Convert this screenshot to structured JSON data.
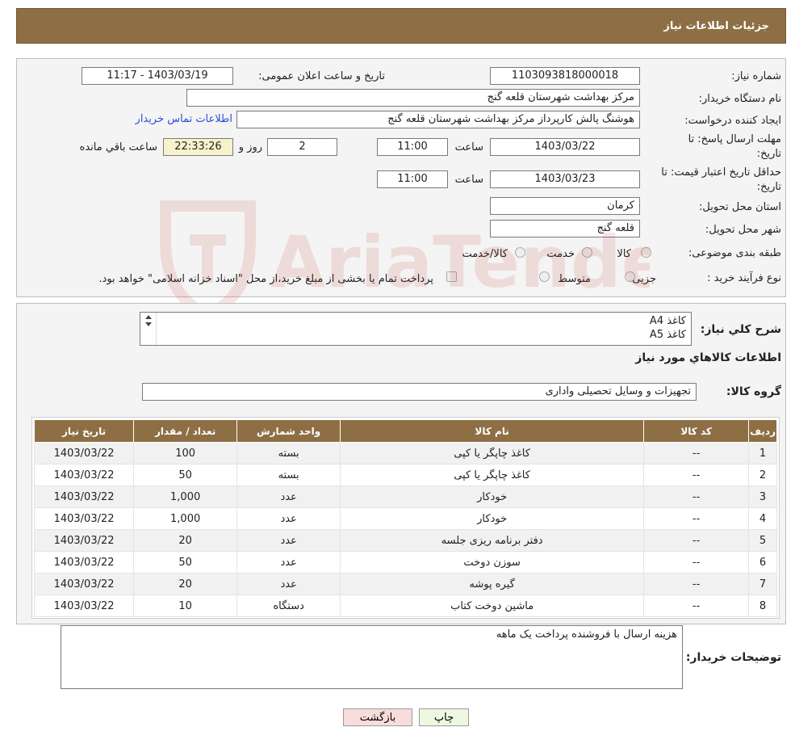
{
  "header": {
    "title": "جزئیات اطلاعات نیاز"
  },
  "fields": {
    "need_number_label": "شماره نیاز:",
    "need_number": "1103093818000018",
    "announce_label": "تاریخ و ساعت اعلان عمومی:",
    "announce_value": "1403/03/19 - 11:17",
    "buyer_org_label": "نام دستگاه خریدار:",
    "buyer_org": "مرکز بهداشت شهرستان قلعه گنج",
    "creator_label": "ایجاد کننده درخواست:",
    "creator": "هوشنگ پالش کارپرداز مرکز بهداشت شهرستان قلعه گنج",
    "contact_link": "اطلاعات تماس خریدار",
    "deadline_label_1": "مهلت ارسال پاسخ: تا",
    "deadline_label_2": "تاریخ:",
    "deadline_date": "1403/03/22",
    "time_label": "ساعت",
    "deadline_time": "11:00",
    "days_value": "2",
    "days_label": "روز و",
    "remaining_value": "22:33:26",
    "remaining_label": "ساعت باقي مانده",
    "validity_label_1": "حداقل تاریخ اعتبار قیمت: تا",
    "validity_label_2": "تاریخ:",
    "validity_date": "1403/03/23",
    "validity_time": "11:00",
    "province_label": "استان محل تحویل:",
    "province": "کرمان",
    "city_label": "شهر محل تحویل:",
    "city": "قلعه گنج",
    "category_label": "طبقه بندی موضوعی:",
    "category_options": [
      "کالا",
      "خدمت",
      "کالا/خدمت"
    ],
    "process_label": "نوع فرآیند خرید :",
    "process_options": [
      "جزیی",
      "متوسط"
    ],
    "process_note": "پرداخت تمام یا بخشی از مبلغ خرید،از محل \"اسناد خزانه اسلامی\" خواهد بود."
  },
  "description": {
    "label": "شرح کلي نیاز:",
    "lines": [
      "کاغذ A4",
      "کاغذ A5"
    ]
  },
  "goods": {
    "section_title": "اطلاعات کالاهاي مورد نیاز",
    "group_label": "گروه کالا:",
    "group_value": "تجهیزات و وسایل تحصیلی واداری",
    "columns": [
      "ردیف",
      "کد کالا",
      "نام کالا",
      "واحد شمارش",
      "تعداد / مقدار",
      "تاریخ نیاز"
    ],
    "rows": [
      [
        "1",
        "--",
        "کاغذ چاپگر یا کپی",
        "بسته",
        "100",
        "1403/03/22"
      ],
      [
        "2",
        "--",
        "کاغذ چاپگر یا کپی",
        "بسته",
        "50",
        "1403/03/22"
      ],
      [
        "3",
        "--",
        "خودکار",
        "عدد",
        "1,000",
        "1403/03/22"
      ],
      [
        "4",
        "--",
        "خودکار",
        "عدد",
        "1,000",
        "1403/03/22"
      ],
      [
        "5",
        "--",
        "دفتر برنامه ریزی جلسه",
        "عدد",
        "20",
        "1403/03/22"
      ],
      [
        "6",
        "--",
        "سوزن دوخت",
        "عدد",
        "50",
        "1403/03/22"
      ],
      [
        "7",
        "--",
        "گیره پوشه",
        "عدد",
        "20",
        "1403/03/22"
      ],
      [
        "8",
        "--",
        "ماشین دوخت کتاب",
        "دستگاه",
        "10",
        "1403/03/22"
      ]
    ]
  },
  "buyer_notes": {
    "label": "توضیحات خریدار:",
    "text": "هزینه ارسال با فروشنده پرداخت یک ماهه"
  },
  "buttons": {
    "print": "چاپ",
    "back": "بازگشت"
  },
  "watermark": {
    "text": "AriaTender.neT",
    "color": "#c0392b"
  },
  "colors": {
    "header_brown": "#8e6f45",
    "print_button_bg": "#eef7e2",
    "back_button_bg": "#f8dcdc",
    "link": "#2b4fd8",
    "remaining_bg": "#f6f3cc"
  }
}
